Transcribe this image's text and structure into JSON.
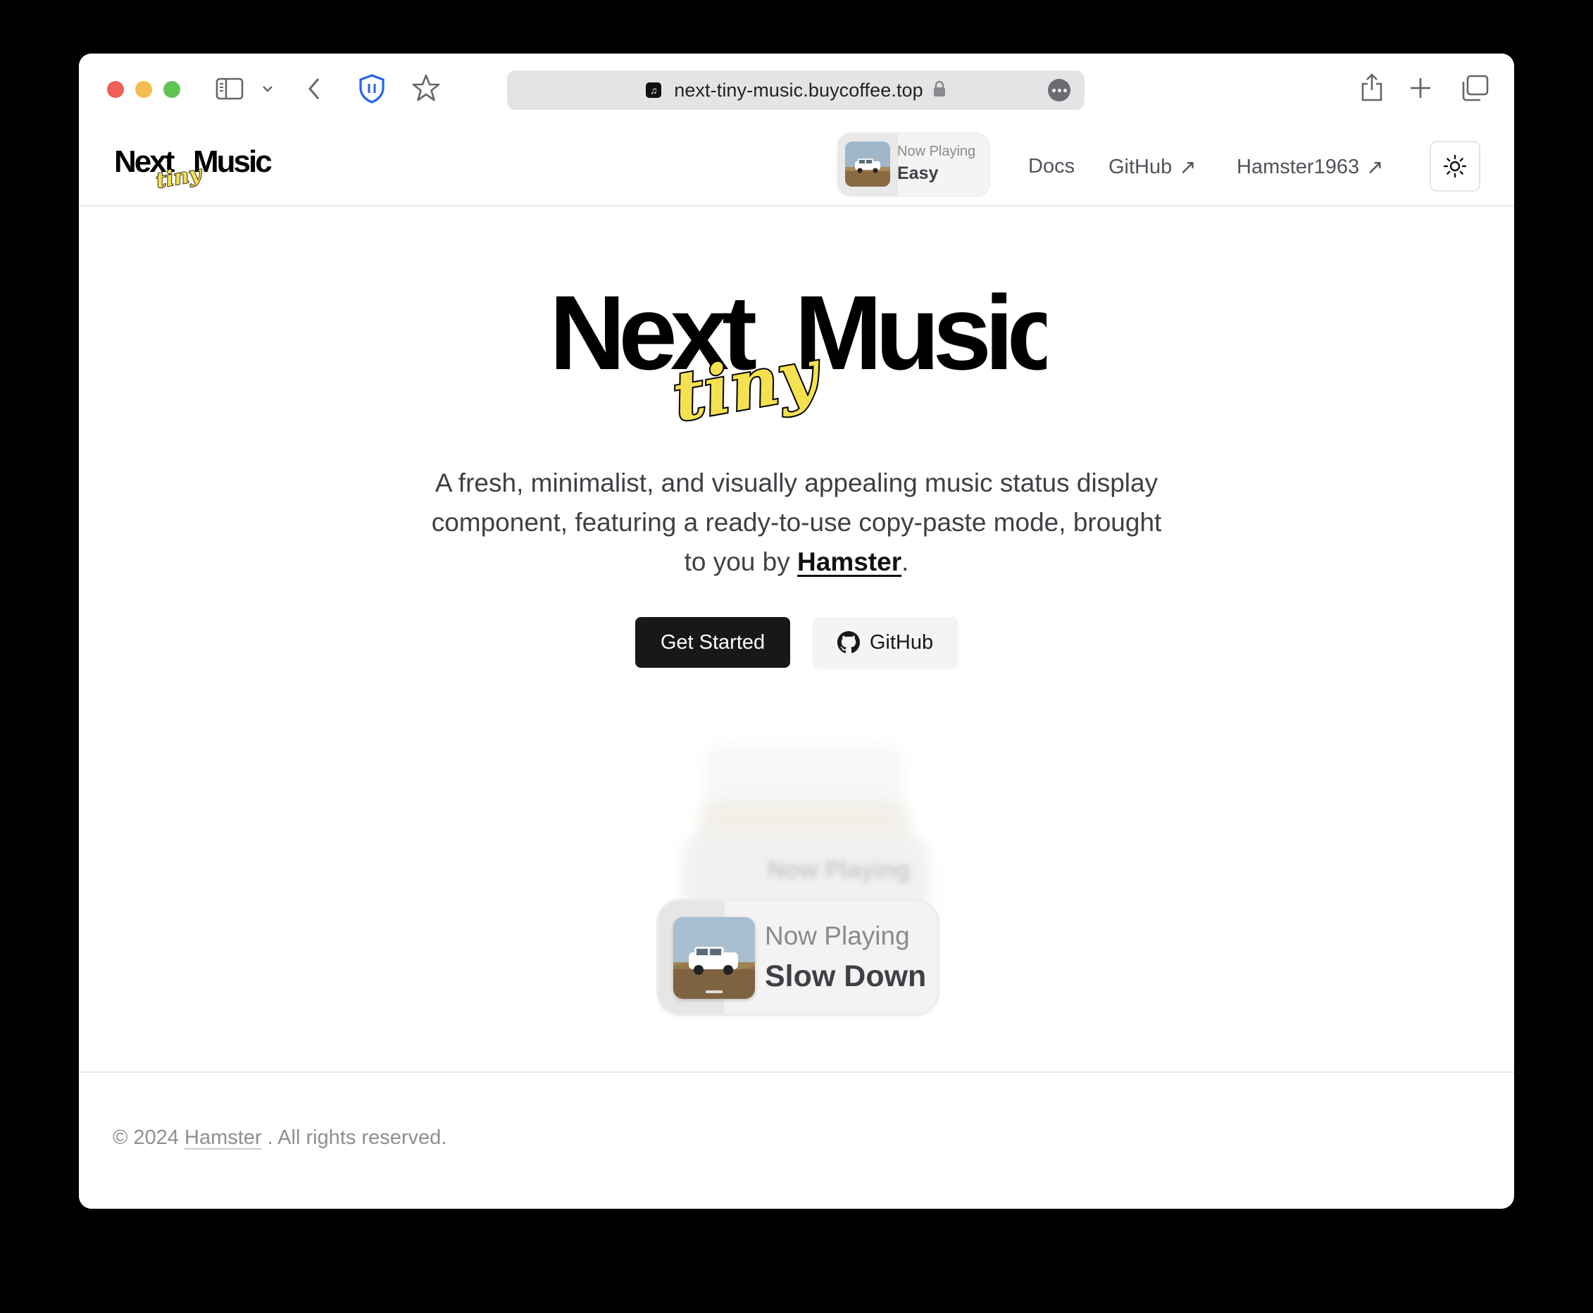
{
  "browser": {
    "url": "next-tiny-music.buycoffee.top"
  },
  "header": {
    "logo_word1": "Next",
    "logo_word2": "Music",
    "logo_accent": "tiny",
    "now_playing": {
      "label": "Now Playing",
      "title": "Easy"
    },
    "nav": {
      "docs": "Docs",
      "github": "GitHub",
      "github_arrow": "↗",
      "user": "Hamster1963",
      "user_arrow": "↗"
    }
  },
  "hero": {
    "logo_word1": "Next",
    "logo_word2": "Music",
    "logo_accent": "tiny",
    "tagline_prefix": "A fresh, minimalist, and visually appealing music status display component, featuring a ready-to-use copy-paste mode, brought to you by ",
    "tagline_link": "Hamster",
    "tagline_suffix": ".",
    "primary_button": "Get Started",
    "secondary_button": "GitHub"
  },
  "demo": {
    "ghost_label": "Now Playing",
    "player": {
      "label": "Now Playing",
      "title": "Slow Down"
    }
  },
  "footer": {
    "copyright_prefix": "© 2024",
    "author_link": "Hamster",
    "copyright_suffix": ". All rights reserved."
  },
  "colors": {
    "accent_yellow": "#f5e050",
    "primary_button": "#18181b",
    "traffic_red": "#ee5f57",
    "traffic_yellow": "#f4bd4f",
    "traffic_green": "#5fc454",
    "shield_blue": "#2563eb"
  }
}
